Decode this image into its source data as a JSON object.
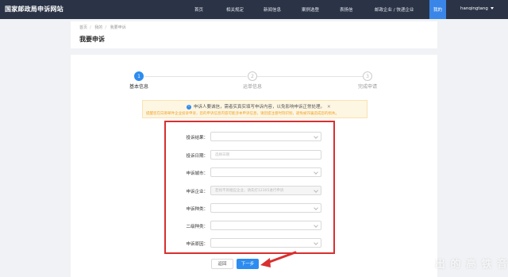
{
  "site_title": "国家邮政局申诉网站",
  "nav": [
    "首页",
    "相关规定",
    "新闻信息",
    "案例选登",
    "表扬信",
    "邮政企业 / 快递企业",
    "我的"
  ],
  "user": "hanqingtang",
  "breadcrumb": [
    "首页",
    "我的",
    "我要申诉"
  ],
  "page_title": "我要申诉",
  "steps": [
    {
      "num": "1",
      "label": "基本信息"
    },
    {
      "num": "2",
      "label": "运单信息"
    },
    {
      "num": "3",
      "label": "完成申请"
    }
  ],
  "notice": {
    "info": "申诉人要诚信，需者实真实填写申诉内容，以免影响申诉正常处理。",
    "warn": "提醒您在向寄邮件企业投诉申诉，您的申诉信息内容可能涉本申诉信息，请您提注意时刻识别，避免被诈骗造成您的损失。"
  },
  "form": {
    "complaint_result_label": "投诉结果：",
    "complaint_date_label": "投诉日期：",
    "complaint_date_placeholder": "选择日期",
    "city_label": "申诉城市：",
    "company_label": "申诉企业：",
    "company_placeholder": "若找不到相应企业，请先打12305进行申诉",
    "type_label": "申诉种类：",
    "subtype_label": "二级种类：",
    "reason_label": "申诉原因："
  },
  "buttons": {
    "back": "返回",
    "next": "下一步"
  },
  "watermark": "出 的 高 铁 音",
  "colors": {
    "nav_bg": "#2b3447",
    "accent": "#2d8cf0",
    "highlight": "#d93030"
  }
}
